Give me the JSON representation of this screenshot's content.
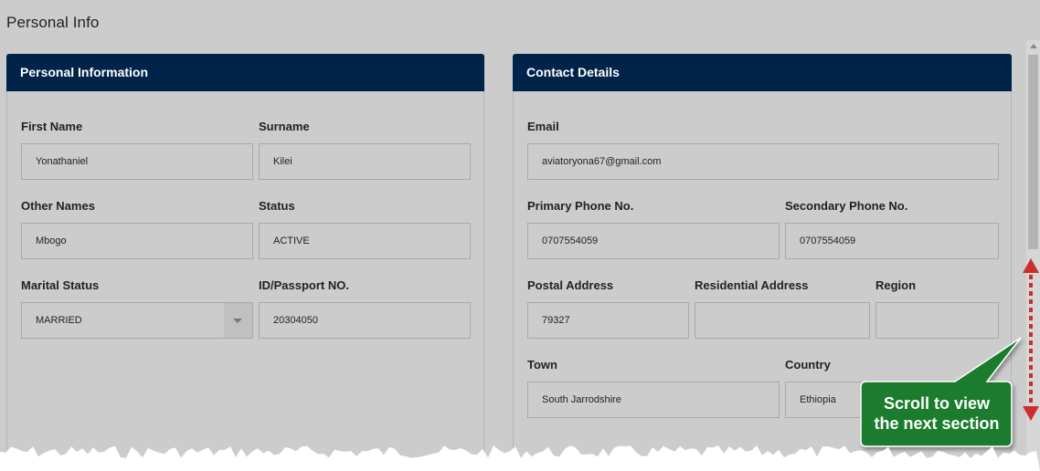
{
  "page": {
    "title": "Personal Info"
  },
  "personal": {
    "header": "Personal Information",
    "first_name": {
      "label": "First Name",
      "value": "Yonathaniel"
    },
    "surname": {
      "label": "Surname",
      "value": "Kilei"
    },
    "other_names": {
      "label": "Other Names",
      "value": "Mbogo"
    },
    "status": {
      "label": "Status",
      "value": "ACTIVE"
    },
    "marital_status": {
      "label": "Marital Status",
      "value": "MARRIED"
    },
    "id_passport": {
      "label": "ID/Passport NO.",
      "value": "20304050"
    }
  },
  "contact": {
    "header": "Contact Details",
    "email": {
      "label": "Email",
      "value": "aviatoryona67@gmail.com"
    },
    "primary_phone": {
      "label": "Primary Phone No.",
      "value": "0707554059"
    },
    "secondary_phone": {
      "label": "Secondary Phone No.",
      "value": "0707554059"
    },
    "postal_address": {
      "label": "Postal Address",
      "value": "79327"
    },
    "residential_address": {
      "label": "Residential Address",
      "value": ""
    },
    "region": {
      "label": "Region",
      "value": ""
    },
    "town": {
      "label": "Town",
      "value": "South Jarrodshire"
    },
    "country": {
      "label": "Country",
      "value": "Ethiopia"
    }
  },
  "callout": {
    "line1": "Scroll to view",
    "line2": "the next section"
  },
  "colors": {
    "header_bg": "#00234a",
    "callout_bg": "#1e7b2e",
    "arrow": "#cc2e2e",
    "page_bg": "#cccccc"
  }
}
